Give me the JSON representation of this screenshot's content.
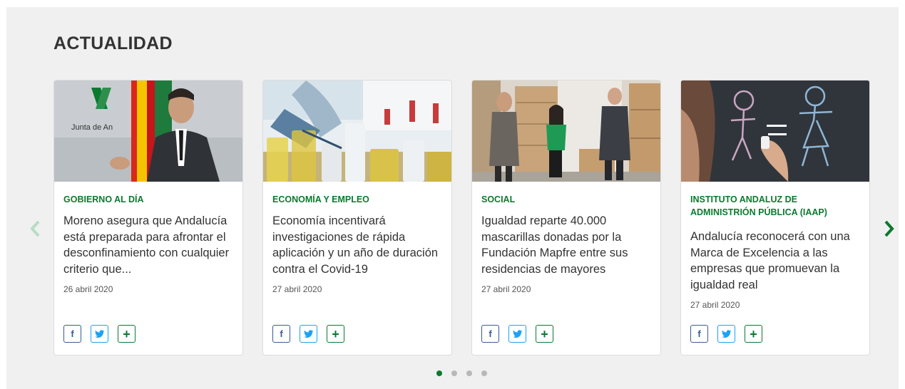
{
  "section": {
    "title": "ACTUALIDAD"
  },
  "colors": {
    "accent": "#0a7a2f",
    "facebook": "#3b5998",
    "twitter": "#1da1f2"
  },
  "cards": [
    {
      "category": "GOBIERNO AL DÍA",
      "headline": "Moreno asegura que Andalucía está preparada para afrontar el desconfinamiento con cualquier criterio que...",
      "date": "26 abril 2020",
      "image_text": "Junta de An"
    },
    {
      "category": "ECONOMÍA Y EMPLEO",
      "headline": "Economía incentivará investigaciones de rápida aplicación y un año de duración contra el Covid-19",
      "date": "27 abril 2020"
    },
    {
      "category": "SOCIAL",
      "headline": "Igualdad reparte 40.000 mascarillas donadas por la Fundación Mapfre entre sus residencias de mayores",
      "date": "27 abril 2020"
    },
    {
      "category": "INSTITUTO ANDALUZ DE ADMINISTRIÓN PÚBLICA (IAAP)",
      "headline": "Andalucía reconocerá con una Marca de Excelencia a las empresas que promuevan la igualdad real",
      "date": "27 abril 2020"
    }
  ],
  "share_buttons": {
    "facebook": "f",
    "plus": "+"
  },
  "icons": [
    "chevron-left-icon",
    "chevron-right-icon",
    "facebook-icon",
    "twitter-icon",
    "plus-icon"
  ],
  "carousel": {
    "pages": 4,
    "active_page": 1
  }
}
